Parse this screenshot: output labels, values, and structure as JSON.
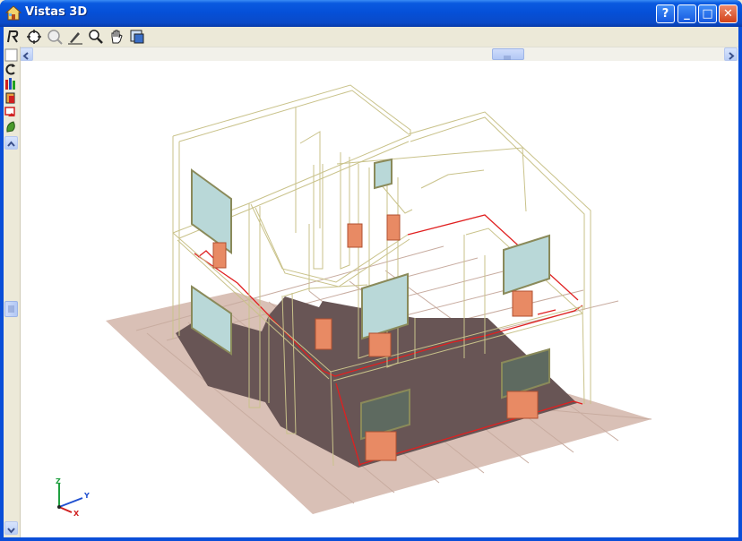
{
  "window": {
    "title": "Vistas 3D"
  },
  "titlebar_buttons": [
    {
      "name": "help-button",
      "glyph": "?"
    },
    {
      "name": "minimize-button",
      "glyph": "_"
    },
    {
      "name": "maximize-button",
      "glyph": "□"
    },
    {
      "name": "close-button",
      "glyph": "✕"
    }
  ],
  "toolbar": {
    "tools": [
      "render-icon",
      "zoom-extents-icon",
      "zoom-previous-icon",
      "zoom-window-icon",
      "zoom-realtime-icon",
      "pan-icon",
      "view-settings-icon"
    ]
  },
  "left_tools": [
    "select-icon",
    "rotate-icon",
    "layers-icon",
    "elevation-icon",
    "hide-icon",
    "color-icon"
  ],
  "axes": {
    "x": "X",
    "y": "Y",
    "z": "Z"
  },
  "colors": {
    "titlebar": "#0a52dd",
    "floor_tile": "#d9bfb4",
    "slab": "#695656",
    "wire": "#c9c28a",
    "pipe": "#e02020",
    "radiator": "#e88a64",
    "glass": "#b9d8d8"
  }
}
